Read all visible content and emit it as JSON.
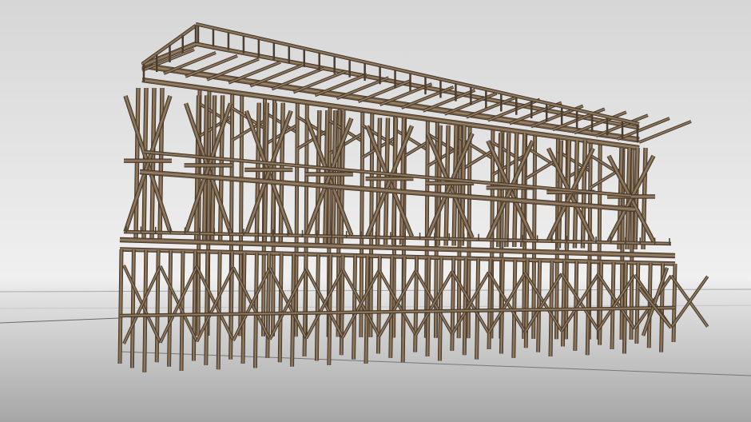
{
  "viewport": {
    "background_top": "#d9d9d9",
    "background_horizon": "#eeeeee",
    "background_bottom": "#a8a8a8",
    "ground_line": "#8f8f8f",
    "guide_line": "#6e6e6e"
  },
  "model": {
    "timber_color": "#6e5a45",
    "timber_light": "#9a8468",
    "timber_dark": "#3d3024",
    "railing_color": "#4a3c2e"
  }
}
